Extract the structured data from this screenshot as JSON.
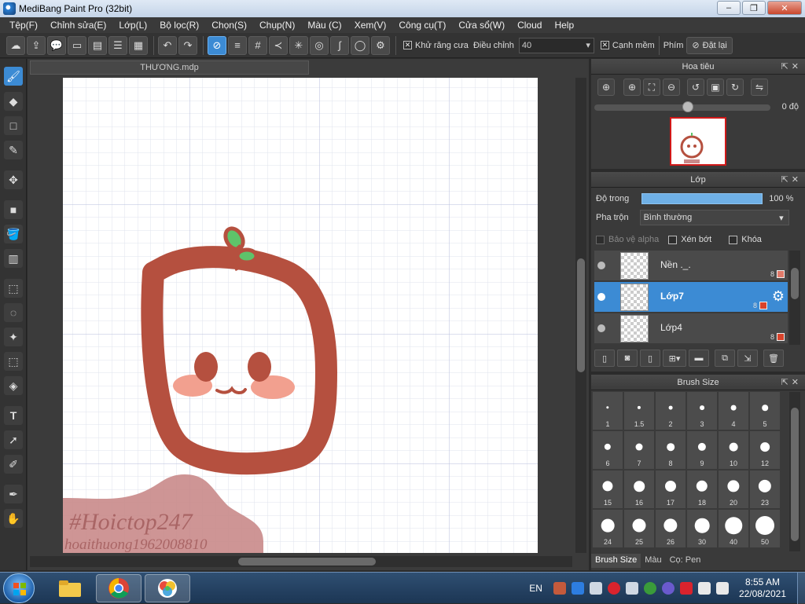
{
  "window": {
    "title": "MediBang Paint Pro (32bit)",
    "min": "‒",
    "max": "❐",
    "close": "✕"
  },
  "menu": [
    "Tệp(F)",
    "Chỉnh sửa(E)",
    "Lớp(L)",
    "Bộ lọc(R)",
    "Chọn(S)",
    "Chụp(N)",
    "Màu (C)",
    "Xem(V)",
    "Công cụ(T)",
    "Cửa sổ(W)",
    "Cloud",
    "Help"
  ],
  "toolbar": {
    "antialias_label": "Khử răng cưa",
    "antialias_checked": true,
    "adjust_label": "Điều chỉnh",
    "adjust_value": "40",
    "snap_label": "Cạnh mềm",
    "snap_checked": true,
    "key_label": "Phím",
    "reset_label": "Đặt lại"
  },
  "document": {
    "tab_title": "THƯƠNG.mdp"
  },
  "navigator": {
    "title": "Hoa tiêu",
    "rotation": "0 độ"
  },
  "layers_panel": {
    "title": "Lớp",
    "opacity_label": "Độ trong",
    "opacity_value": "100 %",
    "blend_label": "Pha trộn",
    "blend_value": "Bình thường",
    "protect_alpha": "Bảo vệ alpha",
    "clipping": "Xén bớt",
    "lock": "Khóa",
    "layers": [
      {
        "name": "Nền ._.",
        "bits": "8",
        "color": "#e07a6a",
        "selected": false
      },
      {
        "name": "Lớp7",
        "bits": "8",
        "color": "#d9432b",
        "selected": true
      },
      {
        "name": "Lớp4",
        "bits": "8",
        "color": "#d9432b",
        "selected": false
      }
    ]
  },
  "brush_panel": {
    "title": "Brush Size",
    "sizes": [
      "1",
      "1.5",
      "2",
      "3",
      "4",
      "5",
      "6",
      "7",
      "8",
      "9",
      "10",
      "12",
      "15",
      "16",
      "17",
      "18",
      "20",
      "23",
      "24",
      "25",
      "26",
      "30",
      "40",
      "50"
    ],
    "tabs": [
      "Brush Size",
      "Màu",
      "Cọ: Pen"
    ]
  },
  "canvas_art": {
    "watermark_line1": "#Hoictop247",
    "watermark_line2": "hoaithuong1962008810"
  },
  "taskbar": {
    "language": "EN",
    "time": "8:55 AM",
    "date": "22/08/2021"
  },
  "colors": {
    "accent": "#3c8bd4",
    "character_brown": "#b5503f",
    "blush": "#f2a08f",
    "smudge": "#c98a8a"
  }
}
